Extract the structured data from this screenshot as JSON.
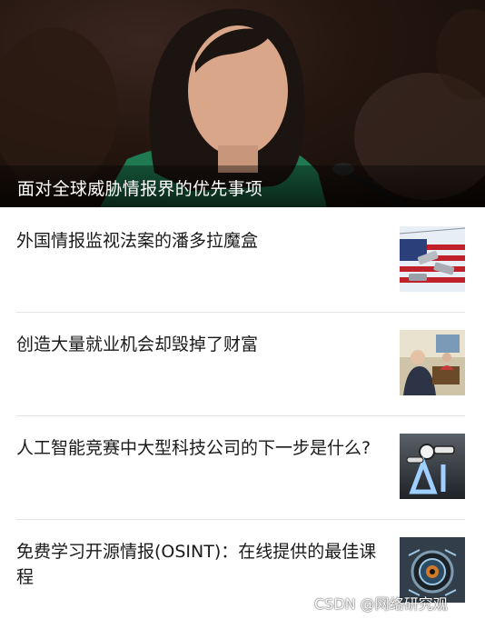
{
  "hero": {
    "caption": "面对全球威胁情报界的优先事项"
  },
  "articles": [
    {
      "title": "外国情报监视法案的潘多拉魔盒",
      "thumb_icon": "flag-surveillance-camera-image"
    },
    {
      "title": "创造大量就业机会却毁掉了财富",
      "thumb_icon": "office-people-image"
    },
    {
      "title": "人工智能竞赛中大型科技公司的下一步是什么?",
      "thumb_icon": "robot-ai-letters-image"
    },
    {
      "title": "免费学习开源情报(OSINT)：在线提供的最佳课程",
      "thumb_icon": "cyber-eye-image"
    }
  ],
  "watermark": "CSDN @网络研究观"
}
